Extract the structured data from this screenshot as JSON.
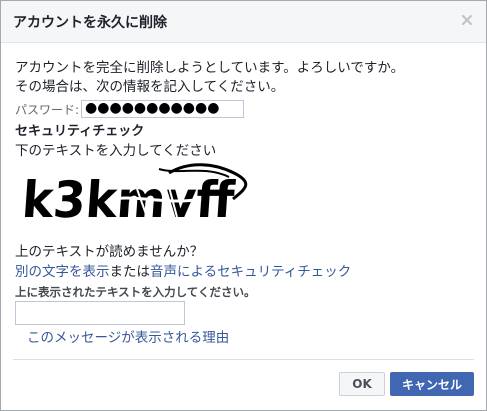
{
  "dialog": {
    "title": "アカウントを永久に削除",
    "close_icon": "close-icon",
    "message_line1": "アカウントを完全に削除しようとしています。よろしいですか。",
    "message_line2": "その場合は、次の情報を記入してください。",
    "password_label": "パスワード:",
    "password_value": "●●●●●●●●●●●",
    "security_heading": "セキュリティチェック",
    "security_instruction": "下のテキストを入力してください",
    "captcha_text": "k3kmvff",
    "cant_read": "上のテキストが読めませんか？",
    "alt_link_text": "別の文字を表示",
    "alt_or": "または",
    "audio_link_text": "音声によるセキュリティチェック",
    "enter_above_label": "上に表示されたテキストを入力してください。",
    "captcha_input_value": "",
    "reason_link": "このメッセージが表示される理由",
    "ok_button": "OK",
    "cancel_button": "キャンセル"
  },
  "colors": {
    "link": "#365899",
    "primary_button": "#4267b2",
    "header_bg": "#f5f6f7"
  }
}
